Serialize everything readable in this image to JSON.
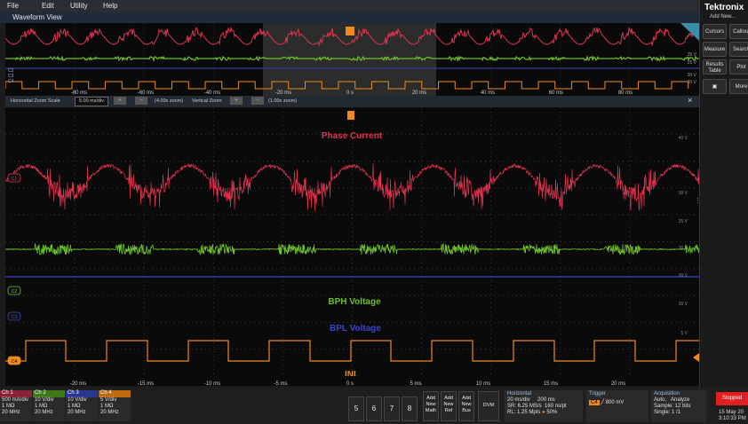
{
  "menu": [
    "File",
    "Edit",
    "Utility",
    "Help"
  ],
  "window_title": "Waveform View",
  "brand": "Tektronix",
  "add_new": "Add New...",
  "right_buttons": [
    "Cursors",
    "Callout",
    "Measure",
    "Search",
    "Results Table",
    "Plot",
    "",
    "More"
  ],
  "zoom": {
    "horizontal_label": "Horizontal Zoom Scale",
    "horizontal_value": "5.00 ms/div",
    "horizontal_zoom": "(4.00x zoom)",
    "vertical_label": "Vertical Zoom",
    "vertical_zoom": "(1.00x zoom)"
  },
  "overview_xticks": [
    "-80 ms",
    "-60 ms",
    "-40 ms",
    "-20 ms",
    "0 s",
    "20 ms",
    "40 ms",
    "60 ms",
    "80 ms"
  ],
  "overview_right": [
    "35 V",
    "25 V",
    "30 V",
    "30 V"
  ],
  "overview_ch": [
    "C2",
    "C3",
    "C4"
  ],
  "main_xticks": [
    "-20 ms",
    "-15 ms",
    "-10 ms",
    "-5 ms",
    "0 s",
    "5 ms",
    "10 ms",
    "15 ms",
    "20 ms"
  ],
  "main_right": [
    "40 V",
    "30 V",
    "25 V",
    "30 V",
    "30 V",
    "30 V",
    "5 V"
  ],
  "main_ch": [
    "C1",
    "C2",
    "C3",
    "C4"
  ],
  "annotations": {
    "phase": "Phase Current",
    "bph": "BPH Voltage",
    "bpl": "BPL Voltage",
    "inl": "INL"
  },
  "colors": {
    "ch1": "#e0334e",
    "ch2": "#6dbf2a",
    "ch3": "#3a44c8",
    "ch4": "#f08a1d",
    "trigger": "#f08a1d"
  },
  "channels": [
    {
      "name": "Ch 1",
      "scale": "500 mA/div",
      "imp": "1 MΩ",
      "bw": "20 MHz",
      "color": "#8b2236"
    },
    {
      "name": "Ch 2",
      "scale": "10 V/div",
      "imp": "1 MΩ",
      "bw": "20 MHz",
      "color": "#3f7a1a"
    },
    {
      "name": "Ch 3",
      "scale": "10 V/div",
      "imp": "1 MΩ",
      "bw": "20 MHz",
      "color": "#2a3790"
    },
    {
      "name": "Ch 4",
      "scale": "5 V/div",
      "imp": "1 MΩ",
      "bw": "20 MHz",
      "color": "#c06a10"
    }
  ],
  "num_buttons": [
    "5",
    "6",
    "7",
    "8"
  ],
  "add_buttons": [
    "Add New Math",
    "Add New Ref",
    "Add New Bus"
  ],
  "dvm": "DVM",
  "horizontal": {
    "title": "Horizontal",
    "l1": "20 ms/div",
    "r1": "200 ms",
    "l2": "SR: 6.25 MS/s",
    "r2": "160 ns/pt",
    "l3": "RL: 1.25 Mpts",
    "r3": "50%"
  },
  "trigger": {
    "title": "Trigger",
    "ch": "C4",
    "value": "800 mV"
  },
  "acquisition": {
    "title": "Acquisition",
    "l1": "Auto,",
    "r1": "Analyze",
    "l2": "Sample: 12 bits",
    "l3": "Single: 1 /1"
  },
  "status": {
    "state": "Stopped",
    "date": "15 May 20",
    "time": "3:10:33 PM"
  }
}
